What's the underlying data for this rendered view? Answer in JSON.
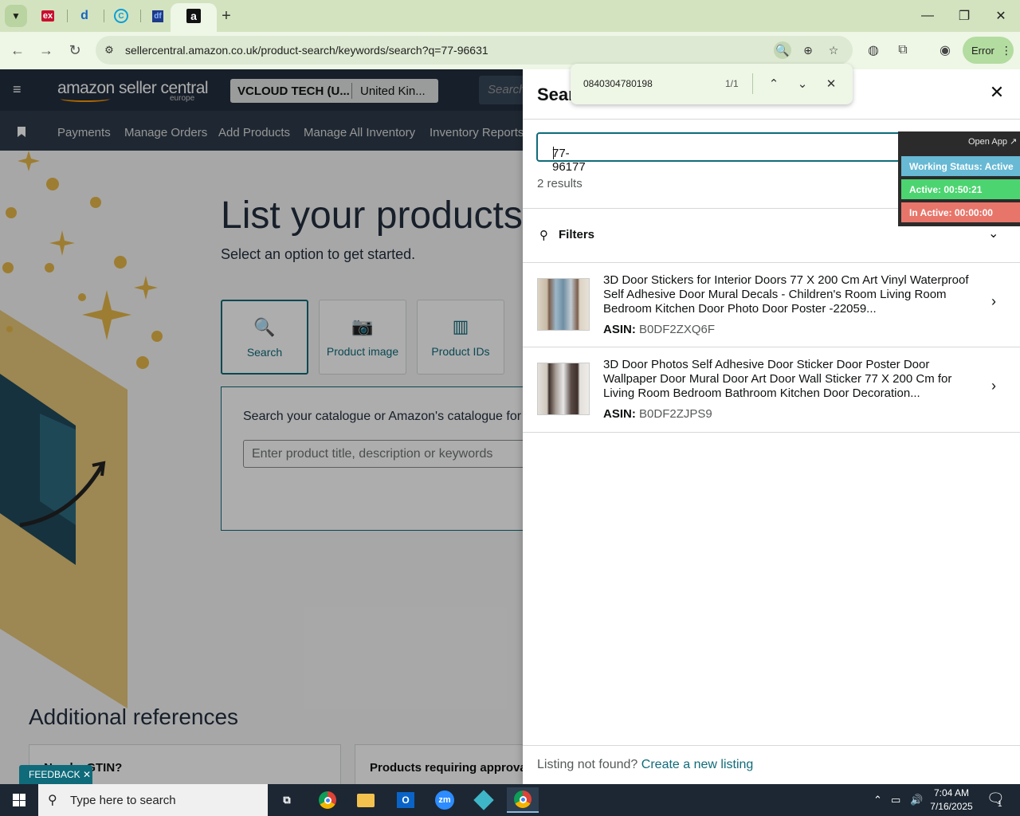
{
  "browser": {
    "tabs": [
      {
        "icon": "ex-icon",
        "glyph": "ex",
        "color": "#c8102e"
      },
      {
        "icon": "app-icon",
        "glyph": "d",
        "color": "#1565c0"
      },
      {
        "icon": "c-icon",
        "glyph": "C",
        "color": "#0aa0d8"
      },
      {
        "icon": "df-icon",
        "glyph": "df",
        "color": "#1e3a8a"
      },
      {
        "icon": "amazon-icon",
        "glyph": "a",
        "color": "#111111"
      }
    ],
    "new_tab": "+",
    "url": "sellercentral.amazon.co.uk/product-search/keywords/search?q=77-96631",
    "profile_chip": "Error"
  },
  "find_bar": {
    "query": "0840304780198",
    "count": "1/1"
  },
  "seller_central": {
    "logo": "amazon seller central",
    "logo_sub": "europe",
    "account_name": "VCLOUD TECH (U...",
    "account_region": "United Kin...",
    "search_placeholder": "Search",
    "nav_items": [
      "Payments",
      "Manage Orders",
      "Add Products",
      "Manage All Inventory",
      "Inventory Reports"
    ],
    "hero_title": "List your products",
    "hero_subtitle": "Select an option to get started.",
    "options": [
      "Search",
      "Product image",
      "Product IDs"
    ],
    "catalog_text": "Search your catalogue or Amazon's catalogue for a",
    "catalog_placeholder": "Enter product title, description or keywords",
    "additional_refs": "Additional references",
    "ref_cards": [
      "Need a GTIN?",
      "Products requiring approva"
    ],
    "feedback": "FEEDBACK"
  },
  "panel": {
    "title": "Sear",
    "search_value": "77-96177",
    "results_count": "2 results",
    "filters_label": "Filters",
    "results": [
      {
        "title": "3D Door Stickers for Interior Doors 77 X 200 Cm Art Vinyl Waterproof Self Adhesive Door Mural Decals - Children's Room Living Room Bedroom Kitchen Door Photo Door Poster -22059...",
        "asin_label": "ASIN:",
        "asin": "B0DF2ZXQ6F"
      },
      {
        "title": "3D Door Photos Self Adhesive Door Sticker Door Poster Door Wallpaper Door Mural Door Art Door Wall Sticker 77 X 200 Cm for Living Room Bedroom Bathroom Kitchen Door Decoration...",
        "asin_label": "ASIN:",
        "asin": "B0DF2ZJPS9"
      }
    ],
    "listing_not_found": "Listing not found?",
    "create_listing": "Create a new listing"
  },
  "status_widget": {
    "open_app": "Open App ↗",
    "working_status": "Working Status: Active",
    "active": "Active: 00:50:21",
    "inactive": "In Active: 00:00:00",
    "colors": {
      "working": "#67b9d4",
      "active": "#4cd471",
      "inactive": "#e8756a"
    }
  },
  "taskbar": {
    "search_placeholder": "Type here to search",
    "time": "7:04 AM",
    "date": "7/16/2025",
    "notification_count": "1"
  }
}
